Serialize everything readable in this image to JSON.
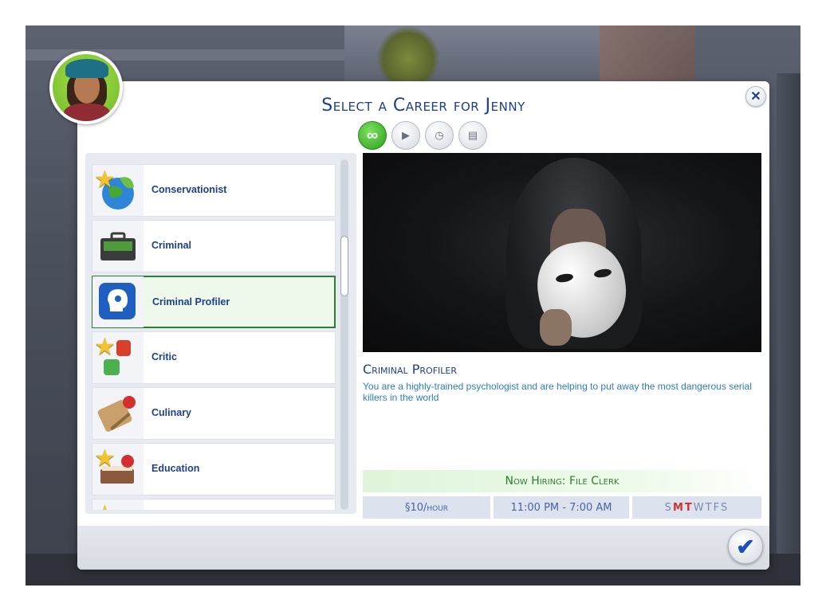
{
  "dialog": {
    "title": "Select a Career for Jenny",
    "close_icon": "close-icon",
    "confirm_icon": "checkmark-icon"
  },
  "tabs": [
    {
      "name": "all-careers",
      "icon": "infinity-icon",
      "glyph": "∞",
      "active": true
    },
    {
      "name": "part-time",
      "icon": "briefcase-play-icon",
      "glyph": "▶",
      "active": false
    },
    {
      "name": "work-from-home",
      "icon": "briefcase-clock-icon",
      "glyph": "◷",
      "active": false
    },
    {
      "name": "freelance",
      "icon": "briefcase-stack-icon",
      "glyph": "▤",
      "active": false
    }
  ],
  "careers": [
    {
      "label": "Conservationist",
      "icon": "globe-leaf-icon",
      "starred": true,
      "selected": false
    },
    {
      "label": "Criminal",
      "icon": "money-briefcase-icon",
      "starred": false,
      "selected": false
    },
    {
      "label": "Criminal Profiler",
      "icon": "profile-head-icon",
      "starred": false,
      "selected": true
    },
    {
      "label": "Critic",
      "icon": "thumbs-up-down-icon",
      "starred": true,
      "selected": false
    },
    {
      "label": "Culinary",
      "icon": "cutting-board-icon",
      "starred": false,
      "selected": false
    },
    {
      "label": "Education",
      "icon": "book-apple-icon",
      "starred": true,
      "selected": false
    },
    {
      "label": "",
      "icon": "partial-career-icon",
      "starred": true,
      "selected": false
    }
  ],
  "detail": {
    "title": "Criminal Profiler",
    "description": "You are a highly-trained psychologist and are helping to put away the most dangerous serial killers in the world",
    "image": "masked-hooded-figure"
  },
  "hiring": {
    "text": "Now Hiring: File Clerk"
  },
  "schedule": {
    "pay": "§10/hour",
    "hours": "11:00 PM - 7:00 AM",
    "days": [
      {
        "letter": "S",
        "work": false
      },
      {
        "letter": "M",
        "work": true
      },
      {
        "letter": "T",
        "work": true
      },
      {
        "letter": "W",
        "work": false
      },
      {
        "letter": "T",
        "work": false
      },
      {
        "letter": "F",
        "work": false
      },
      {
        "letter": "S",
        "work": false
      }
    ]
  },
  "colors": {
    "title": "#1d3f8f",
    "description": "#2c7cd0",
    "hiring_text": "#2e7d32",
    "work_day": "#d32f2f",
    "active_tab": "#2f9e1e"
  }
}
